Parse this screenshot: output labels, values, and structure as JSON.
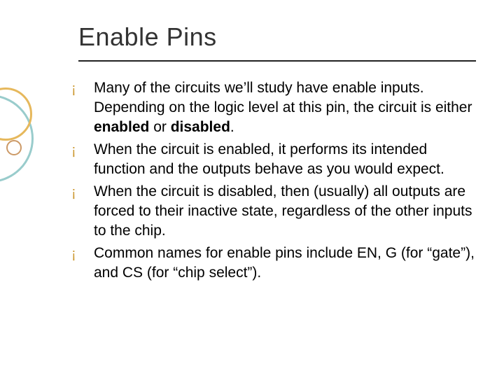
{
  "title": "Enable Pins",
  "bullet_glyph": "¡",
  "items": [
    {
      "pre": "Many of the circuits we’ll study have enable inputs.  Depending on the logic level at this pin, the circuit is either ",
      "b1": "enabled",
      "mid": " or ",
      "b2": "disabled",
      "post": "."
    },
    {
      "pre": "When the circuit is enabled, it performs its intended function and the outputs behave as you would expect.",
      "b1": "",
      "mid": "",
      "b2": "",
      "post": ""
    },
    {
      "pre": "When the circuit is disabled, then (usually) all outputs are forced to their inactive state, regardless of the other inputs to the chip.",
      "b1": "",
      "mid": "",
      "b2": "",
      "post": ""
    },
    {
      "pre": "Common names for enable pins include EN, G (for “gate”), and CS (for “chip select”).",
      "b1": "",
      "mid": "",
      "b2": "",
      "post": ""
    }
  ]
}
